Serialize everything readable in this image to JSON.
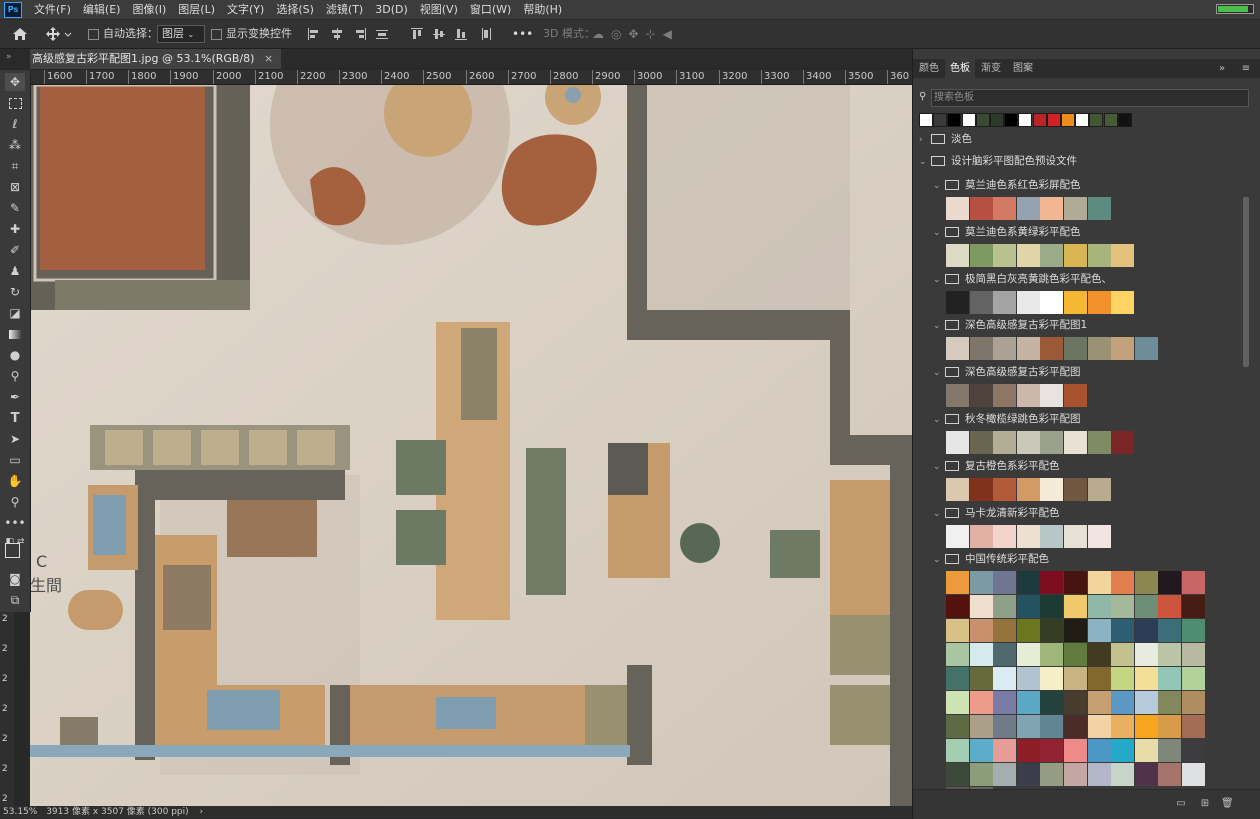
{
  "app": {
    "logo": "Ps"
  },
  "menu": [
    "文件(F)",
    "编辑(E)",
    "图像(I)",
    "图层(L)",
    "文字(Y)",
    "选择(S)",
    "滤镜(T)",
    "3D(D)",
    "视图(V)",
    "窗口(W)",
    "帮助(H)"
  ],
  "options": {
    "home_icon": "home-icon",
    "move_icon": "move-icon",
    "auto_select_label": "自动选择：",
    "auto_select_target": "图层",
    "show_transform_label": "显示变换控件",
    "more": "•••",
    "mode_3d_label": "3D 模式："
  },
  "document": {
    "tab_title": "高级感复古彩平配图1.jpg @ 53.1%(RGB/8)",
    "close": "×",
    "ruler_ticks": [
      "1600",
      "1700",
      "1800",
      "1900",
      "2000",
      "2100",
      "2200",
      "2300",
      "2400",
      "2500",
      "2600",
      "2700",
      "2800",
      "2900",
      "3000",
      "3100",
      "3200",
      "3300",
      "3400",
      "3500",
      "360"
    ],
    "left_ruler_ticks": [
      "2",
      "2",
      "2",
      "2",
      "2",
      "2",
      "2"
    ],
    "canvas_text": [
      "C",
      "生間"
    ]
  },
  "status": {
    "zoom": "53.15%",
    "info": "3913 像素 x 3507 像素 (300 ppi)",
    "arrow": "›"
  },
  "panel": {
    "tabs": [
      "颜色",
      "色板",
      "渐变",
      "图案"
    ],
    "active_tab": "色板",
    "menu_icons": [
      "»",
      "≡"
    ],
    "search_placeholder": "搜索色板",
    "recent_colors": [
      "#ffffff",
      "#3a3a3a",
      "#000000",
      "#ffffff",
      "#3c4a36",
      "#2b3a2a",
      "#000000",
      "#ffffff",
      "#b92525",
      "#d22222",
      "#f08c1e",
      "#ffffff",
      "#3f5a32",
      "#465c36",
      "#111111"
    ],
    "groups": [
      {
        "name": "淡色",
        "expanded": false
      },
      {
        "name": "设计脑彩平图配色预设文件",
        "expanded": true
      }
    ],
    "subgroups": [
      {
        "name": "莫兰迪色系红色彩屏配色",
        "colors": [
          "#ead9cc",
          "#b65043",
          "#d57a62",
          "#94a1ae",
          "#f0b792",
          "#b1aa96",
          "#5d8b80"
        ]
      },
      {
        "name": "莫兰迪色系黄绿彩平配色",
        "colors": [
          "#dcd9c4",
          "#7e9a62",
          "#b9c28f",
          "#e1d4a6",
          "#9bab8a",
          "#d9b554",
          "#a9b47c",
          "#e5c17e"
        ]
      },
      {
        "name": "极简黑白灰亮黄跳色彩平配色、",
        "colors": [
          "#222222",
          "#636363",
          "#a4a4a4",
          "#e9e9e9",
          "#ffffff",
          "#f5b833",
          "#f2902c",
          "#ffd464"
        ]
      },
      {
        "name": "深色高级感复古彩平配图1",
        "colors": [
          "#d5cabd",
          "#7e766b",
          "#aba194",
          "#c3b4a2",
          "#9c5b38",
          "#6b7561",
          "#9b9273",
          "#c2a17b",
          "#6d8d9b"
        ]
      },
      {
        "name": "深色高级感复古彩平配图",
        "colors": [
          "#84786c",
          "#4d423c",
          "#8d7764",
          "#cdb7ad",
          "#e8e3e1",
          "#a9532e"
        ]
      },
      {
        "name": "秋冬橄榄绿跳色彩平配图",
        "colors": [
          "#e6e6e6",
          "#686650",
          "#b2ae95",
          "#c9c8b9",
          "#9aa28d",
          "#e9e1d3",
          "#7e8b63",
          "#7c2527"
        ]
      },
      {
        "name": "复古橙色系彩平配色",
        "colors": [
          "#dcc8ae",
          "#80321c",
          "#b35b39",
          "#d49a66",
          "#f5ead8",
          "#70573f",
          "#b9ac8e"
        ]
      },
      {
        "name": "马卡龙清新彩平配色",
        "colors": [
          "#f0f0f0",
          "#e3b0a5",
          "#f3d4cb",
          "#ede0d0",
          "#b7c7c7",
          "#e7e1d5",
          "#f0e5e0"
        ]
      },
      {
        "name": "中国传统彩平配色",
        "colors": []
      }
    ],
    "chinese_colors": [
      "#ec9a3a",
      "#7b9aa6",
      "#6e7691",
      "#1d3a3c",
      "#7c0d1e",
      "#471411",
      "#f3d49a",
      "#e07f4d",
      "#8c8650",
      "#21191f",
      "#c76664",
      "#54120e",
      "#efdfcf",
      "#8e9f8a",
      "#235361",
      "#1b3a34",
      "#f0c96d",
      "#8fb9a7",
      "#a5b89a",
      "#6e8e76",
      "#ce553d",
      "#451d12",
      "#d7c185",
      "#c9906e",
      "#94733c",
      "#6b771f",
      "#353d25",
      "#221d14",
      "#8cb3c1",
      "#2e5e74",
      "#2e3d57",
      "#3c6e7a",
      "#4e8d70",
      "#a9c6a3",
      "#d5eaed",
      "#4e6a6e",
      "#e7ecd9",
      "#9fb67b",
      "#617a3e",
      "#423a22",
      "#c3c18e",
      "#e9ebe1",
      "#bcc4a6",
      "#b9b9a3",
      "#437368",
      "#676a3d",
      "#dcecf4",
      "#b1c3cf",
      "#f6eec7",
      "#c8b483",
      "#82682d",
      "#c6d582",
      "#f3df98",
      "#92c7b8",
      "#b3d19a",
      "#cee3b4",
      "#ed9c8b",
      "#7a7ca7",
      "#5da7c6",
      "#24413d",
      "#473c2e",
      "#c6a070",
      "#5c98c5",
      "#b6cadb",
      "#82875c",
      "#ae8d60",
      "#5e6a44",
      "#ac9f8a",
      "#707b89",
      "#81a4b2",
      "#5f8692",
      "#4c2c26",
      "#f2d3a5",
      "#e8b060",
      "#f7a51c",
      "#d79b4a",
      "#a46c55",
      "#a4ccb1",
      "#5dadca",
      "#e59d96",
      "#8e1e25",
      "#912232",
      "#ef8a88",
      "#4b97c6",
      "#24aac8",
      "#e8dcaa",
      "#7e8779",
      "#3c3c3e",
      "#3b4a3a",
      "#8c9d7c",
      "#a5aeae",
      "#3b3c4c",
      "#959c84",
      "#c4a7a2",
      "#b3b6c9",
      "#c7d4c7",
      "#50334b",
      "#a7746b",
      "#dee0e1",
      "#5f5453",
      "#63655a"
    ],
    "footer_icons": [
      "folder-icon",
      "new-swatch-icon",
      "trash-icon"
    ]
  }
}
